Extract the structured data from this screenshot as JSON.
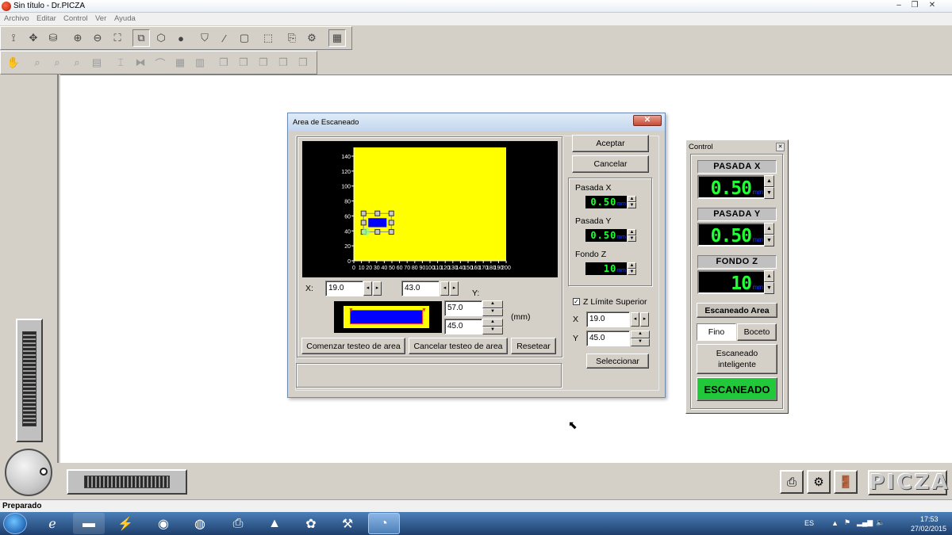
{
  "window": {
    "title": "Sin título - Dr.PICZA",
    "minimize": "–",
    "restore": "❐",
    "close": "✕"
  },
  "menu": [
    "Archivo",
    "Editar",
    "Control",
    "Ver",
    "Ayuda"
  ],
  "toolbar1_icons": [
    "select-icon",
    "move-icon",
    "bucket-icon",
    "zoom-in-icon",
    "zoom-out-icon",
    "zoom-fit-icon",
    "shape-a-icon",
    "shape-b-icon",
    "sphere-icon",
    "paint-icon",
    "brush-icon",
    "rect-icon",
    "object-icon",
    "copy-icon",
    "scan-icon",
    "palette-icon"
  ],
  "toolbar2_icons": [
    "hand-icon",
    "zoom-rect-icon",
    "zoom-a-icon",
    "zoom-b-icon",
    "scan-area-icon",
    "bracket-icon",
    "mirror-icon",
    "arc-icon",
    "grid-icon",
    "grid-b-icon",
    "cube-a-icon",
    "cube-b-icon",
    "cube-c-icon",
    "cube-d-icon",
    "cube-e-icon"
  ],
  "scan_dialog": {
    "title": "Area de Escaneado",
    "close": "✕",
    "plot": {
      "y_ticks": [
        "140",
        "120",
        "100",
        "80",
        "60",
        "40",
        "20",
        "0"
      ],
      "x_ticks": [
        "0",
        "10",
        "20",
        "30",
        "40",
        "50",
        "60",
        "70",
        "80",
        "90",
        "100",
        "110",
        "120",
        "130",
        "140",
        "150",
        "160",
        "170",
        "180",
        "190",
        "200"
      ],
      "area_color": "#ffff00",
      "selection_color": "#0000ff"
    },
    "x_label": "X:",
    "x_value": "19.0",
    "x2_value": "43.0",
    "y_label": "Y:",
    "size_width": "57.0",
    "size_height": "45.0",
    "unit_mm": "(mm)",
    "btn_start_test": "Comenzar testeo de area",
    "btn_cancel_test": "Cancelar testeo de area",
    "btn_reset": "Resetear",
    "btn_accept": "Aceptar",
    "btn_cancel": "Cancelar",
    "pasada_x_label": "Pasada X",
    "pasada_x_value": "0.50",
    "pasada_y_label": "Pasada Y",
    "pasada_y_value": "0.50",
    "fondo_z_label": "Fondo Z",
    "fondo_z_value": "10",
    "mm": "mm",
    "z_limit_checked": true,
    "z_limit_label": "Z Límite Superior",
    "z_x_label": "X",
    "z_x_value": "19.0",
    "z_y_label": "Y",
    "z_y_value": "45.0",
    "btn_select": "Seleccionar"
  },
  "control_panel": {
    "title": "Control",
    "pasada_x_head": "PASADA X",
    "pasada_x_value": "0.50",
    "pasada_y_head": "PASADA Y",
    "pasada_y_value": "0.50",
    "fondo_z_head": "FONDO Z",
    "fondo_z_value": "10",
    "mm": "mm",
    "btn_scan_area": "Escaneado Area",
    "btn_fino": "Fino",
    "btn_boceto": "Boceto",
    "btn_smart_scan": "Escaneado inteligente",
    "btn_scan": "ESCANEADO",
    "scan_color": "#21c93a"
  },
  "logo": "PICZA",
  "status": "Preparado",
  "taskbar": {
    "apps": [
      "explorer-icon",
      "ie-icon",
      "folder-icon",
      "acrobat-icon",
      "firefox-icon",
      "chrome-icon",
      "printer-icon",
      "media-icon",
      "paint-icon",
      "tool-icon",
      "picza-icon"
    ],
    "lang": "ES",
    "time": "17:53",
    "date": "27/02/2015"
  }
}
